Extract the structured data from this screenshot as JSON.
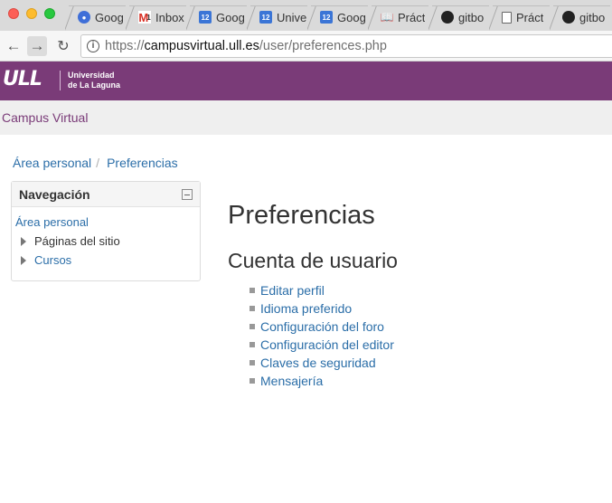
{
  "browser": {
    "tabs": [
      {
        "label": "Goog",
        "icon": "google-account-icon"
      },
      {
        "label": "Inbox",
        "icon": "gmail-icon",
        "badge": "1"
      },
      {
        "label": "Goog",
        "icon": "calendar-icon",
        "badge": "12"
      },
      {
        "label": "Unive",
        "icon": "calendar-icon",
        "badge": "12"
      },
      {
        "label": "Goog",
        "icon": "calendar-icon",
        "badge": "12"
      },
      {
        "label": "Práct",
        "icon": "book-icon"
      },
      {
        "label": "gitbo",
        "icon": "github-icon"
      },
      {
        "label": "Práct",
        "icon": "document-icon"
      },
      {
        "label": "gitbo",
        "icon": "github-icon"
      }
    ],
    "url": {
      "scheme": "https://",
      "host": "campusvirtual.ull.es",
      "path": "/user/preferences.php"
    }
  },
  "header": {
    "logo_text": "ULL",
    "institution_line1": "Universidad",
    "institution_line2": "de La Laguna",
    "brand_color": "#7a3b78"
  },
  "navbar": {
    "site_name": "Campus Virtual"
  },
  "breadcrumb": [
    {
      "label": "Área personal"
    },
    {
      "label": "Preferencias"
    }
  ],
  "navigation_block": {
    "title": "Navegación",
    "home_link": "Área personal",
    "items": [
      {
        "label": "Páginas del sitio",
        "link": false
      },
      {
        "label": "Cursos",
        "link": true
      }
    ]
  },
  "main": {
    "title": "Preferencias",
    "section_title": "Cuenta de usuario",
    "links": [
      "Editar perfil",
      "Idioma preferido",
      "Configuración del foro",
      "Configuración del editor",
      "Claves de seguridad",
      "Mensajería"
    ],
    "link_color": "#2b6ea8"
  }
}
